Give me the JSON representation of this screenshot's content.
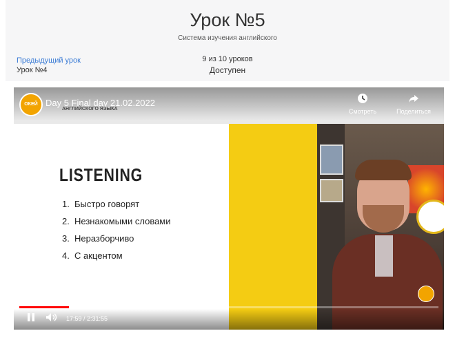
{
  "header": {
    "title": "Урок №5",
    "subtitle": "Система изучения английского",
    "prev_label": "Предыдущий урок",
    "prev_lesson": "Урок №4",
    "counter": "9 из 10 уроков",
    "status": "Доступен"
  },
  "video": {
    "title": "Day 5 Final day 21.02.2022",
    "channel_logo_text": "ОКЕЙ",
    "course_subtitle": "АНГЛИЙСКОГО ЯЗЫКА",
    "watch_later": "Смотреть",
    "share": "Поделиться",
    "slide_heading": "LISTENING",
    "slide_items": [
      {
        "num": "1.",
        "text": "Быстро говорят"
      },
      {
        "num": "2.",
        "text": "Незнакомыми словами"
      },
      {
        "num": "3.",
        "text": "Неразборчиво"
      },
      {
        "num": "4.",
        "text": "С акцентом"
      }
    ],
    "time_display": "17:59 / 2:31:55",
    "progress": 0.118
  },
  "colors": {
    "accent_link": "#3a7bd5",
    "slide_yellow": "#f4cc13",
    "progress_red": "#ff0000"
  },
  "icons": [
    "pause-icon",
    "volume-icon",
    "clock-icon",
    "share-icon"
  ]
}
